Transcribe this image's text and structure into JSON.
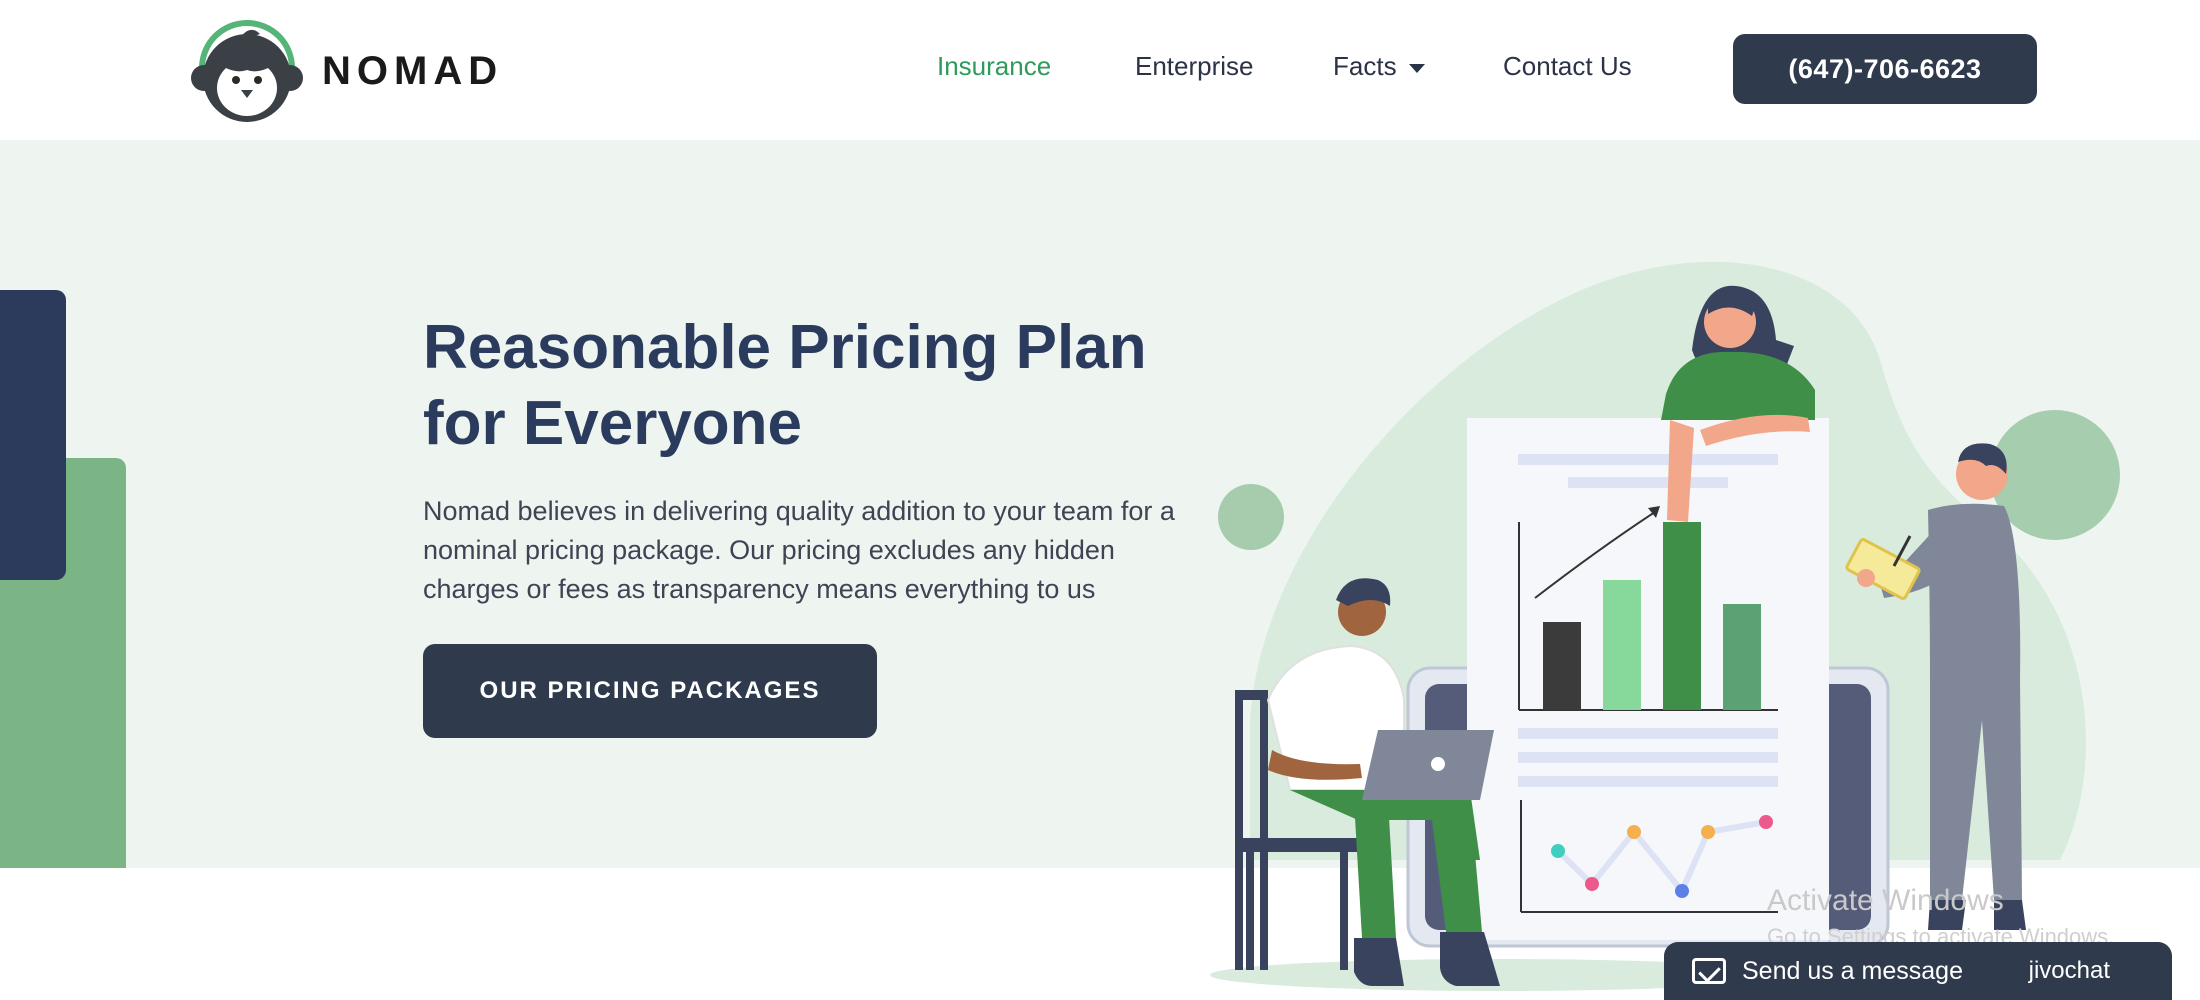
{
  "brand": {
    "name": "NOMAD",
    "logo_icon": "penguin-headphones-logo"
  },
  "nav": {
    "items": [
      {
        "label": "Insurance",
        "active": true
      },
      {
        "label": "Enterprise",
        "active": false
      },
      {
        "label": "Facts",
        "active": false,
        "has_dropdown": true
      },
      {
        "label": "Contact Us",
        "active": false
      }
    ],
    "phone": "(647)-706-6623"
  },
  "hero": {
    "title_line1": "Reasonable Pricing Plan",
    "title_line2": "for Everyone",
    "description_line1": "Nomad believes in delivering quality addition to your team for a",
    "description_line2": "nominal pricing package. Our pricing excludes any hidden",
    "description_line3": "charges or fees as transparency means everything to us",
    "cta_label": "OUR PRICING PACKAGES"
  },
  "watermark": {
    "line1": "Activate Windows",
    "line2": "Go to Settings to activate Windows."
  },
  "chat_widget": {
    "label": "Send us a message",
    "brand": "jivochat",
    "icon": "envelope-icon"
  },
  "colors": {
    "accent_green": "#2e9a5c",
    "navy": "#2f3a4d",
    "hero_bg": "#eef5f0",
    "title": "#2b3b5e"
  }
}
